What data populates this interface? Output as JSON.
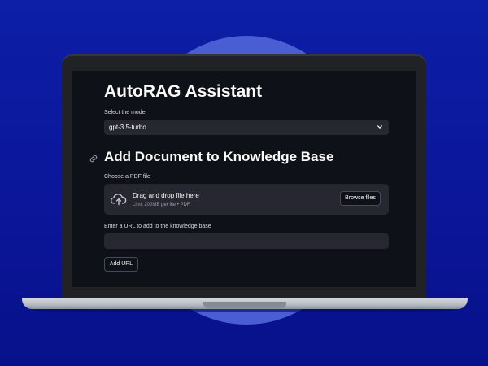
{
  "app": {
    "title": "AutoRAG Assistant"
  },
  "model_select": {
    "label": "Select the model",
    "value": "gpt-3.5-turbo"
  },
  "document_section": {
    "title": "Add Document to Knowledge Base",
    "pdf_label": "Choose a PDF file",
    "dropzone_title": "Drag and drop file here",
    "dropzone_limit": "Limit 200MB per file • PDF",
    "browse_label": "Browse files",
    "url_label": "Enter a URL to add to the knowledge base",
    "url_value": "",
    "add_url_label": "Add URL"
  },
  "icons": [
    "chevron-down-icon",
    "link-icon",
    "cloud-upload-icon"
  ],
  "colors": {
    "background": "#0c1fa6",
    "halo": "#4e62d6",
    "app_bg": "#0e1117",
    "input_bg": "#262730",
    "text": "#fafafa"
  }
}
